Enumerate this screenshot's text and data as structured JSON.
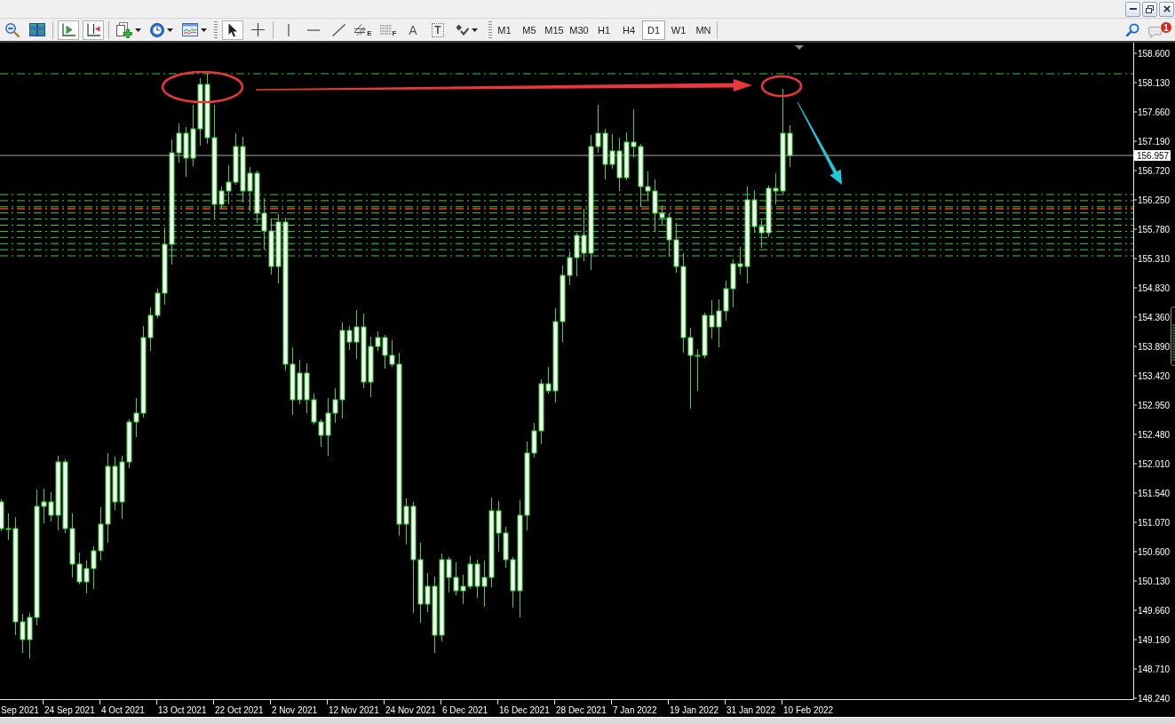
{
  "window_controls": [
    {
      "kind": "minimize"
    },
    {
      "kind": "restore"
    },
    {
      "kind": "close"
    }
  ],
  "toolbars": [
    {
      "groups": [
        [
          {
            "kind": "zoom-out",
            "pressed": false,
            "menu": false
          },
          {
            "kind": "tile-windows",
            "pressed": false,
            "menu": false
          }
        ],
        [
          {
            "kind": "chart-shift",
            "pressed": true,
            "menu": false
          },
          {
            "kind": "auto-scroll",
            "pressed": true,
            "menu": false
          }
        ],
        [
          {
            "kind": "new-chart",
            "pressed": false,
            "menu": true
          },
          {
            "kind": "periods",
            "pressed": false,
            "menu": true
          },
          {
            "kind": "templates",
            "pressed": false,
            "menu": true
          }
        ]
      ]
    },
    {
      "groups": [
        [
          {
            "kind": "cursor",
            "pressed": true,
            "menu": false
          },
          {
            "kind": "crosshair",
            "pressed": false,
            "menu": false
          }
        ],
        [
          {
            "kind": "vertical-line",
            "pressed": false,
            "menu": false
          },
          {
            "kind": "horizontal-line",
            "pressed": false,
            "menu": false
          },
          {
            "kind": "trendline",
            "pressed": false,
            "menu": false
          },
          {
            "kind": "channel",
            "letter": "E",
            "pressed": false,
            "menu": false
          },
          {
            "kind": "fibonacci",
            "letter": "F",
            "pressed": false,
            "menu": false
          },
          {
            "kind": "text",
            "letter": "A",
            "pressed": false,
            "menu": false
          },
          {
            "kind": "text-label",
            "letter": "T",
            "pressed": false,
            "menu": false
          },
          {
            "kind": "arrows",
            "pressed": false,
            "menu": true
          }
        ]
      ]
    }
  ],
  "timeframes": [
    {
      "label": "M1",
      "selected": false
    },
    {
      "label": "M5",
      "selected": false
    },
    {
      "label": "M15",
      "selected": false
    },
    {
      "label": "M30",
      "selected": false
    },
    {
      "label": "H1",
      "selected": false
    },
    {
      "label": "H4",
      "selected": false
    },
    {
      "label": "D1",
      "selected": true
    },
    {
      "label": "W1",
      "selected": false
    },
    {
      "label": "MN",
      "selected": false
    }
  ],
  "right_tools": [
    {
      "kind": "search"
    },
    {
      "kind": "notifications",
      "badge": "1"
    }
  ],
  "chart": {
    "price_labels": [
      "158.600",
      "158.130",
      "157.660",
      "157.190",
      "156.720",
      "156.250",
      "155.780",
      "155.310",
      "154.830",
      "154.360",
      "153.890",
      "153.420",
      "152.950",
      "152.480",
      "152.010",
      "151.540",
      "151.070",
      "150.600",
      "150.130",
      "149.660",
      "149.190",
      "148.710",
      "148.240"
    ],
    "current_price": "156.957",
    "date_labels": [
      "Sep 2021",
      "24 Sep 2021",
      "4 Oct 2021",
      "13 Oct 2021",
      "22 Oct 2021",
      "2 Nov 2021",
      "12 Nov 2021",
      "24 Nov 2021",
      "6 Dec 2021",
      "16 Dec 2021",
      "28 Dec 2021",
      "7 Jan 2022",
      "19 Jan 2022",
      "31 Jan 2022",
      "10 Feb 2022"
    ]
  }
}
